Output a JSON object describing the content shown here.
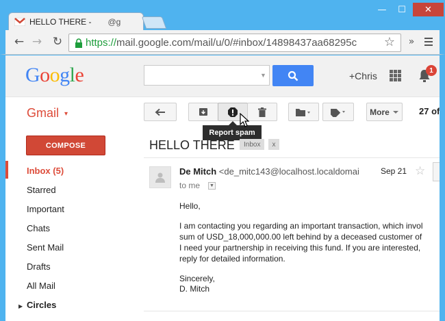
{
  "window": {
    "min_glyph": "—",
    "max_glyph": "☐",
    "close_glyph": "✕"
  },
  "tab": {
    "title": "HELLO THERE -",
    "title_suffix": "@g"
  },
  "browser": {
    "url_https": "https://",
    "url_rest": "mail.google.com/mail/u/0/#inbox/14898437aa68295c",
    "back_glyph": "←",
    "forward_glyph": "→",
    "reload_glyph": "↻",
    "star_glyph": "☆",
    "ext_glyph": "»"
  },
  "header": {
    "logo_letters": [
      {
        "ch": "G",
        "color": "#4285f4"
      },
      {
        "ch": "o",
        "color": "#ea4335"
      },
      {
        "ch": "o",
        "color": "#fbbc05"
      },
      {
        "ch": "g",
        "color": "#4285f4"
      },
      {
        "ch": "l",
        "color": "#34a853"
      },
      {
        "ch": "e",
        "color": "#ea4335"
      }
    ],
    "user": "+Chris",
    "notification_count": "1"
  },
  "app": {
    "label": "Gmail",
    "caret": "▾"
  },
  "toolbar": {
    "more_label": "More",
    "count": "27 of"
  },
  "tooltip": "Report spam",
  "sidebar": {
    "compose": "COMPOSE",
    "items": [
      {
        "label": "Inbox (5)"
      },
      {
        "label": "Starred"
      },
      {
        "label": "Important"
      },
      {
        "label": "Chats"
      },
      {
        "label": "Sent Mail"
      },
      {
        "label": "Drafts"
      },
      {
        "label": "All Mail"
      },
      {
        "label": "Circles"
      }
    ]
  },
  "thread": {
    "subject": "HELLO THERE",
    "label": "Inbox",
    "label_remove": "x"
  },
  "message": {
    "sender_name": "De Mitch",
    "sender_email": "<de_mitc143@localhost.localdomai",
    "date": "Sep 21",
    "to": "to me",
    "star_glyph": "☆",
    "lines": [
      "Hello,",
      "I am contacting you regarding an important transaction, which invol",
      "sum of USD_18,000,000.00 left behind by a deceased customer of",
      "I need your partnership in receiving this fund. If you are interested,",
      "reply for detailed information.",
      "Sincerely,",
      "D. Mitch"
    ]
  }
}
